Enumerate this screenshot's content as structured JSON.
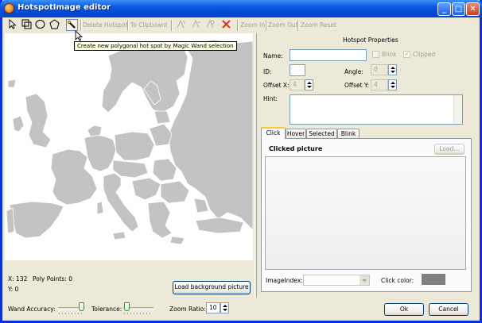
{
  "window": {
    "title": "HotspotImage editor",
    "buttons": {
      "minimize": "_",
      "maximize": "□",
      "close": "✕"
    }
  },
  "toolbar": {
    "delete_hotspot": "Delete Hotspot",
    "to_clipboard": "To Clipboard",
    "zoom_in": "Zoom In",
    "zoom_out": "Zoom Out",
    "zoom_reset": "Zoom Reset",
    "tool_icons": [
      "arrow-pointer-icon",
      "rectangle-tool-icon",
      "ellipse-tool-icon",
      "polygon-tool-icon",
      "magic-wand-icon",
      "add-point-icon",
      "remove-point-icon",
      "edit-point-icon",
      "delete-red-x-icon"
    ]
  },
  "tooltip": "Create new polygonal hot spot by Magic Wand selection",
  "status": {
    "x": "X: 132",
    "poly_points": "Poly Points: 0",
    "y": "Y: 0"
  },
  "load_background_button": "Load background picture",
  "properties": {
    "heading": "Hotspot Properties",
    "name_label": "Name:",
    "name_value": "",
    "blink_label": "Blink",
    "clipped_label": "Clipped",
    "id_label": "ID:",
    "id_value": "",
    "angle_label": "Angle:",
    "angle_value": "0",
    "offset_x_label": "Offset X:",
    "offset_x_value": "4",
    "offset_y_label": "Offset Y:",
    "offset_y_value": "4",
    "hint_label": "Hint:",
    "hint_value": ""
  },
  "tabs": [
    "Click",
    "Hover",
    "Selected",
    "Blink"
  ],
  "click_panel": {
    "heading": "Clicked picture",
    "load_button": "Load...",
    "image_index_label": "ImageIndex:",
    "click_color_label": "Click color:",
    "click_color": "#808080"
  },
  "bottom": {
    "wand_accuracy_label": "Wand Accuracy:",
    "tolerance_label": "Tolerance:",
    "zoom_ratio_label": "Zoom Ratio:",
    "zoom_ratio_value": "10",
    "ok_button": "Ok",
    "cancel_button": "Cancel"
  },
  "colors": {
    "map_land": "#c0c0c0",
    "window_bg": "#ece9d8",
    "titlebar": "#0a58e0"
  }
}
